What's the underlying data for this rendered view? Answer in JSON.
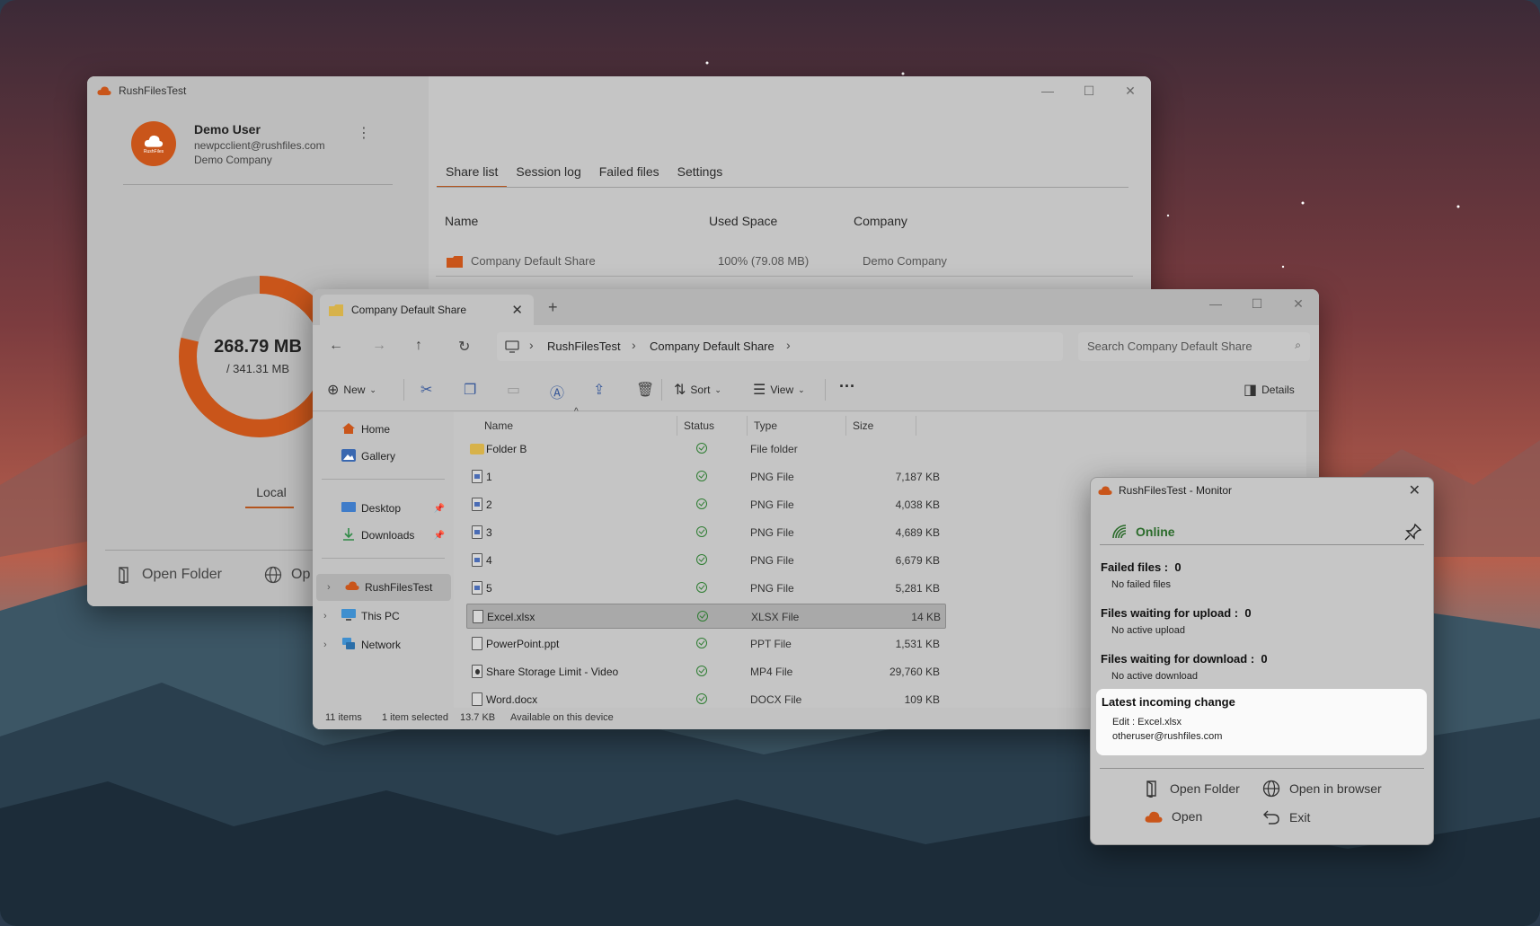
{
  "main_window": {
    "app_title": "RushFilesTest",
    "user": {
      "name": "Demo User",
      "email": "newpcclient@rushfiles.com",
      "company": "Demo Company",
      "avatar_label": "RushFiles"
    },
    "storage": {
      "used": "268.79 MB",
      "total": "/ 341.31 MB",
      "used_fraction": 0.7875
    },
    "local_tab": "Local",
    "actions": {
      "open_folder": "Open Folder",
      "open_browser_partial": "Op"
    },
    "tabs": [
      "Share list",
      "Session log",
      "Failed files",
      "Settings"
    ],
    "columns": {
      "name": "Name",
      "used_space": "Used Space",
      "company": "Company"
    },
    "shares": [
      {
        "name": "Company Default Share",
        "used": "100% (79.08 MB)",
        "company": "Demo Company"
      }
    ]
  },
  "explorer": {
    "tab_title": "Company Default Share",
    "breadcrumb": [
      "RushFilesTest",
      "Company Default Share"
    ],
    "search_placeholder": "Search Company Default Share",
    "toolbar": {
      "new": "New",
      "sort": "Sort",
      "view": "View",
      "details": "Details"
    },
    "nav": {
      "home": "Home",
      "gallery": "Gallery",
      "desktop": "Desktop",
      "downloads": "Downloads",
      "rushfiles": "RushFilesTest",
      "this_pc": "This PC",
      "network": "Network"
    },
    "columns": {
      "name": "Name",
      "status": "Status",
      "type": "Type",
      "size": "Size"
    },
    "files": [
      {
        "name": "Folder B",
        "type": "File folder",
        "size": "",
        "icon": "folder"
      },
      {
        "name": "1",
        "type": "PNG File",
        "size": "7,187 KB",
        "icon": "png"
      },
      {
        "name": "2",
        "type": "PNG File",
        "size": "4,038 KB",
        "icon": "png"
      },
      {
        "name": "3",
        "type": "PNG File",
        "size": "4,689 KB",
        "icon": "png"
      },
      {
        "name": "4",
        "type": "PNG File",
        "size": "6,679 KB",
        "icon": "png"
      },
      {
        "name": "5",
        "type": "PNG File",
        "size": "5,281 KB",
        "icon": "png"
      },
      {
        "name": "Excel.xlsx",
        "type": "XLSX File",
        "size": "14 KB",
        "icon": "doc",
        "selected": true
      },
      {
        "name": "PowerPoint.ppt",
        "type": "PPT File",
        "size": "1,531 KB",
        "icon": "doc"
      },
      {
        "name": "Share Storage Limit - Video",
        "type": "MP4 File",
        "size": "29,760 KB",
        "icon": "video"
      },
      {
        "name": "Word.docx",
        "type": "DOCX File",
        "size": "109 KB",
        "icon": "doc"
      }
    ],
    "status": {
      "count": "11 items",
      "selected": "1 item selected",
      "size": "13.7 KB",
      "availability": "Available on this device"
    }
  },
  "monitor": {
    "title": "RushFilesTest - Monitor",
    "online": "Online",
    "failed_label": "Failed files :",
    "failed_count": "0",
    "failed_sub": "No failed files",
    "upload_label": "Files waiting for upload :",
    "upload_count": "0",
    "upload_sub": "No active upload",
    "download_label": "Files waiting for download :",
    "download_count": "0",
    "download_sub": "No active download",
    "latest_label": "Latest incoming change",
    "latest_edit": "Edit : Excel.xlsx",
    "latest_user": "otheruser@rushfiles.com",
    "actions": {
      "open_folder": "Open Folder",
      "open_browser": "Open in browser",
      "open": "Open",
      "exit": "Exit"
    }
  },
  "colors": {
    "brand_orange": "#c9551a",
    "online_green": "#2b6b2b"
  }
}
